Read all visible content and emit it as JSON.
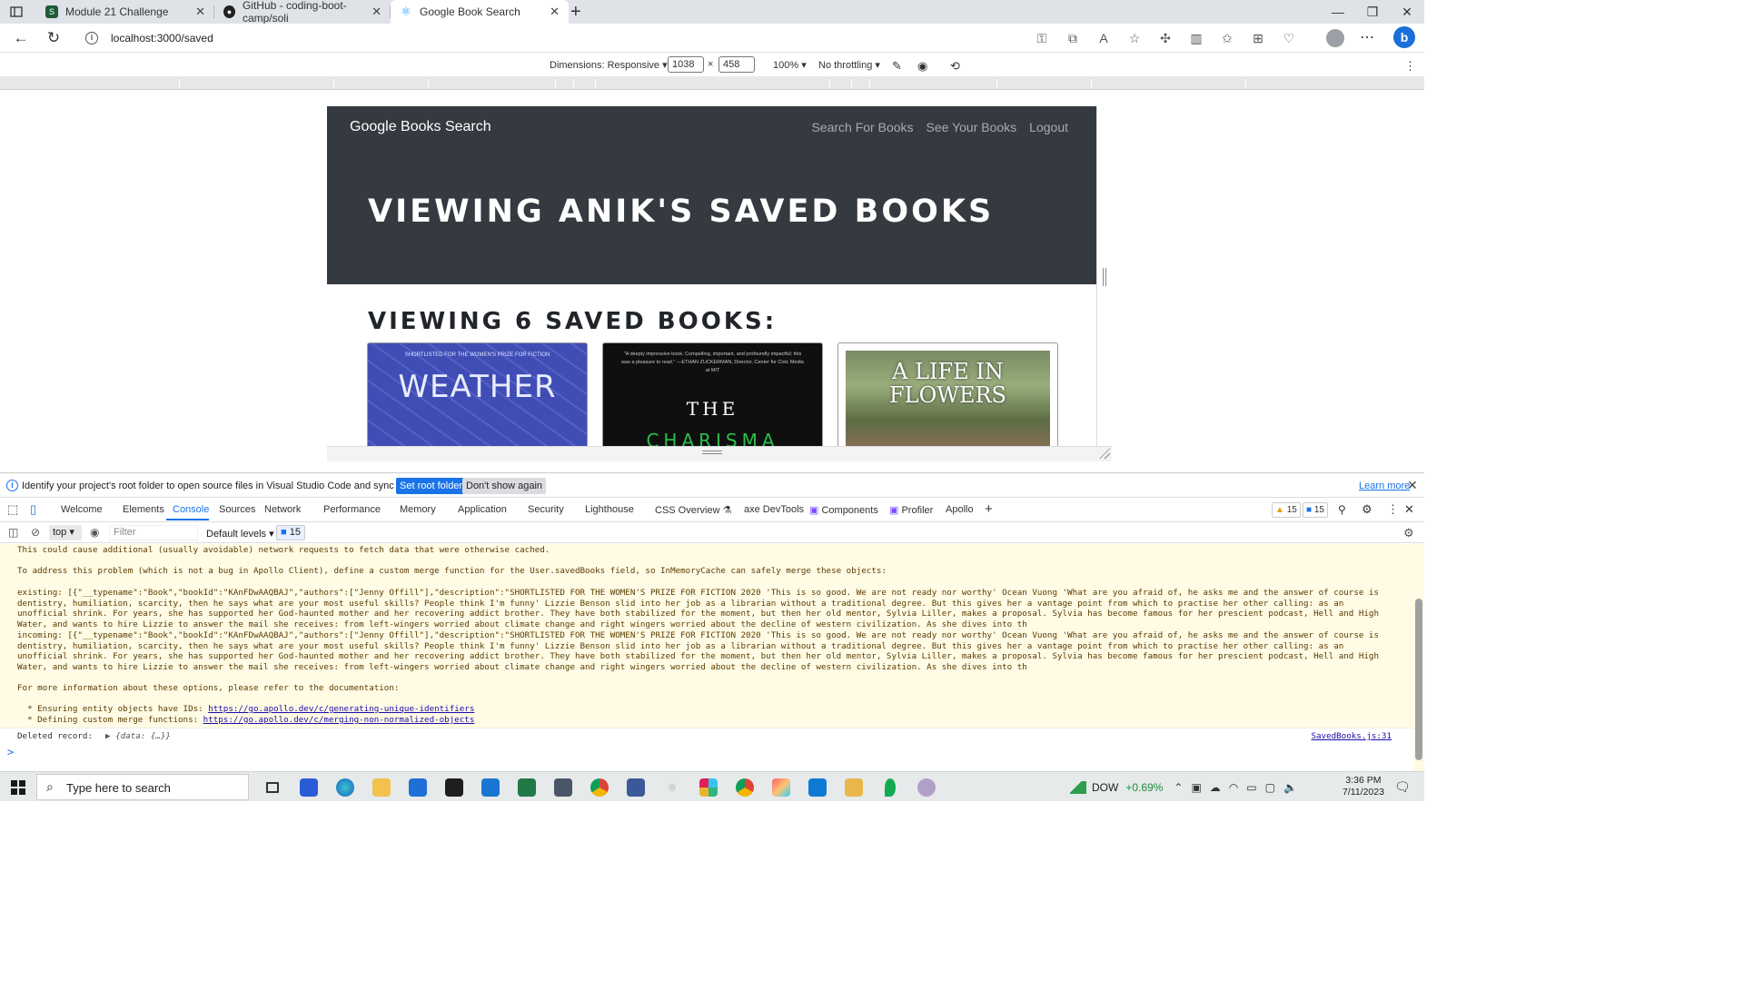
{
  "browser": {
    "tabs": [
      {
        "title": "Module 21 Challenge"
      },
      {
        "title": "GitHub - coding-boot-camp/soli"
      },
      {
        "title": "Google Book Search"
      }
    ],
    "url": "localhost:3000/saved"
  },
  "device_toolbar": {
    "dimensions_label": "Dimensions: Responsive",
    "width": "1038",
    "height": "458",
    "times": "×",
    "zoom": "100%",
    "throttling": "No throttling"
  },
  "app": {
    "brand": "Google Books Search",
    "nav": [
      "Search For Books",
      "See Your Books",
      "Logout"
    ],
    "hero_title": "VIEWING ANIK'S SAVED BOOKS",
    "count_title": "VIEWING 6 SAVED BOOKS:",
    "books": [
      {
        "tagline": "SHORTLISTED FOR THE WOMEN'S PRIZE FOR FICTION",
        "cover_title": "WEATHER"
      },
      {
        "quote": "\"A deeply impressive book. Compelling, important, and profoundly impactful; this was a pleasure to read.\" —ETHAN ZUCKERMAN, Director, Center for Civic Media at MIT",
        "cover_title_1": "THE",
        "cover_title_2": "CHARISMA"
      },
      {
        "cover_title": "A LIFE IN FLOWERS"
      }
    ]
  },
  "infobar": {
    "text": "Identify your project's root folder to open source files in Visual Studio Code and sync changes.",
    "primary_button": "Set root folder",
    "secondary_button": "Don't show again",
    "link": "Learn more"
  },
  "devtools": {
    "tabs": [
      "Welcome",
      "Elements",
      "Console",
      "Sources",
      "Network",
      "Performance",
      "Memory",
      "Application",
      "Security",
      "Lighthouse",
      "CSS Overview",
      "axe DevTools",
      "Components",
      "Profiler",
      "Apollo"
    ],
    "active_tab": "Console",
    "warnings_count": "15",
    "info_count": "15",
    "context": "top",
    "filter_placeholder": "Filter",
    "levels": "Default levels",
    "message_count": "15"
  },
  "console": {
    "line1": "This could cause additional (usually avoidable) network requests to fetch data that were otherwise cached.",
    "line2": "To address this problem (which is not a bug in Apollo Client), define a custom merge function for the User.savedBooks field, so InMemoryCache can safely merge these objects:",
    "existing": "  existing: [{\"__typename\":\"Book\",\"bookId\":\"KAnFDwAAQBAJ\",\"authors\":[\"Jenny Offill\"],\"description\":\"SHORTLISTED FOR THE WOMEN'S PRIZE FOR FICTION 2020 'This is so good. We are not ready nor worthy' Ocean Vuong 'What are you afraid of, he asks me and the answer of course is dentistry, humiliation, scarcity, then he says what are your most useful skills? People think I'm funny' Lizzie Benson slid into her job as a librarian without a traditional degree. But this gives her a vantage point from which to practise her other calling: as an unofficial shrink. For years, she has supported her God-haunted mother and her recovering addict brother. They have both stabilized for the moment, but then her old mentor, Sylvia Liller, makes a proposal. Sylvia has become famous for her prescient podcast, Hell and High Water, and wants to hire Lizzie to answer the mail she receives: from left-wingers worried about climate change and right wingers worried about the decline of western civilization. As she dives into th",
    "incoming": "  incoming: [{\"__typename\":\"Book\",\"bookId\":\"KAnFDwAAQBAJ\",\"authors\":[\"Jenny Offill\"],\"description\":\"SHORTLISTED FOR THE WOMEN'S PRIZE FOR FICTION 2020 'This is so good. We are not ready nor worthy' Ocean Vuong 'What are you afraid of, he asks me and the answer of course is dentistry, humiliation, scarcity, then he says what are your most useful skills? People think I'm funny' Lizzie Benson slid into her job as a librarian without a traditional degree. But this gives her a vantage point from which to practise her other calling: as an unofficial shrink. For years, she has supported her God-haunted mother and her recovering addict brother. They have both stabilized for the moment, but then her old mentor, Sylvia Liller, makes a proposal. Sylvia has become famous for her prescient podcast, Hell and High Water, and wants to hire Lizzie to answer the mail she receives: from left-wingers worried about climate change and right wingers worried about the decline of western civilization. As she dives into th",
    "more_info": "For more information about these options, please refer to the documentation:",
    "bullet1_label": "  * Ensuring entity objects have IDs: ",
    "bullet1_link": "https://go.apollo.dev/c/generating-unique-identifiers",
    "bullet2_label": "  * Defining custom merge functions: ",
    "bullet2_link": "https://go.apollo.dev/c/merging-non-normalized-objects",
    "deleted_label": "Deleted record:",
    "deleted_obj": "▶ {data: {…}}",
    "source": "SavedBooks.js:31",
    "prompt": ">"
  },
  "taskbar": {
    "search_placeholder": "Type here to search",
    "ticker": "DOW",
    "ticker_change": "+0.69%",
    "time": "3:36 PM",
    "date": "7/11/2023"
  }
}
